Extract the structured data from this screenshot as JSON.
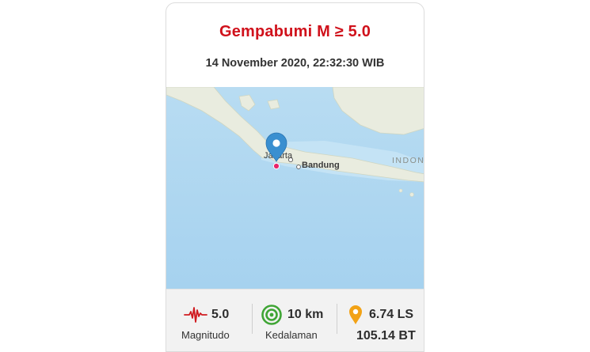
{
  "header": {
    "title": "Gempabumi M ≥ 5.0",
    "datetime": "14 November 2020, 22:32:30 WIB"
  },
  "map": {
    "labels": {
      "jakarta": "Jakarta",
      "bandung": "Bandung",
      "indonesia": "INDON"
    },
    "marker_icon": "map-pin-icon",
    "epicenter_icon": "epicenter-dot-icon"
  },
  "stats": {
    "magnitude": {
      "icon": "seismograph-icon",
      "value": "5.0",
      "label": "Magnitudo"
    },
    "depth": {
      "icon": "concentric-circles-icon",
      "value": "10 km",
      "label": "Kedalaman"
    },
    "location": {
      "icon": "location-pin-icon",
      "lat": "6.74 LS",
      "lon": "105.14 BT"
    }
  },
  "colors": {
    "title": "#d0111b",
    "ocean": "#a9d4ef",
    "land": "#e9ecdf",
    "pin": "#3a8fd0",
    "magnitude_icon": "#d01b20",
    "depth_icon": "#3fa535",
    "location_icon": "#f2a215"
  }
}
